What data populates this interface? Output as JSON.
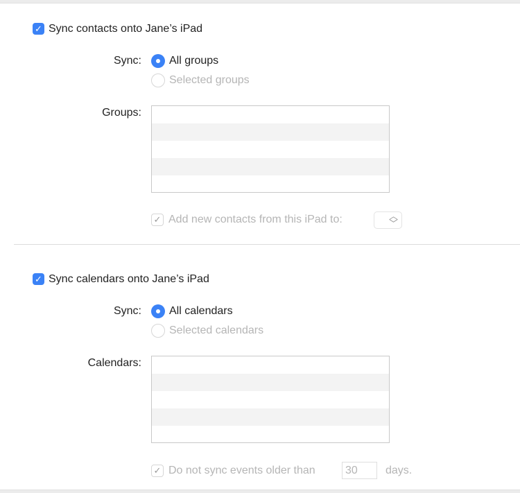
{
  "contacts": {
    "sync_checkbox": "Sync contacts onto Jane’s iPad",
    "sync_label": "Sync:",
    "option_all": "All groups",
    "option_selected": "Selected groups",
    "list_label": "Groups:",
    "add_new_label": "Add new contacts from this iPad to:"
  },
  "calendars": {
    "sync_checkbox": "Sync calendars onto Jane’s iPad",
    "sync_label": "Sync:",
    "option_all": "All calendars",
    "option_selected": "Selected calendars",
    "list_label": "Calendars:",
    "older_label": "Do not sync events older than",
    "days_value": "30",
    "days_unit": "days."
  },
  "colors": {
    "accent": "#3b82f6"
  }
}
